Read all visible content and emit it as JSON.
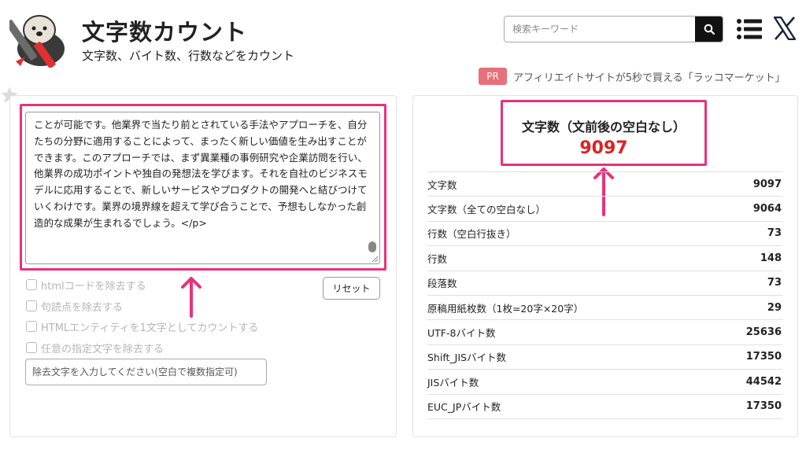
{
  "header": {
    "title": "文字数カウント",
    "subtitle": "文字数、バイト数、行数などをカウント"
  },
  "search": {
    "placeholder": "検索キーワード"
  },
  "promo": {
    "badge": "PR",
    "text": "アフィリエイトサイトが5秒で買える「ラッコマーケット」"
  },
  "editor": {
    "lines": [
      "ことが可能です。他業界で当たり前とされている手法やアプローチを、自分",
      "たちの分野に適用することによって、まったく新しい価値を生み出すことが",
      "できます。このアプローチでは、まず異業種の事例研究や企業訪問を行い、",
      "他業界の成功ポイントや独自の発想法を学びます。それを自社のビジネスモ",
      "デルに応用することで、新しいサービスやプロダクトの開発へと結びつけて",
      "いくわけです。業界の境界線を超えて学び合うことで、予想もしなかった創",
      "造的な成果が生まれるでしょう。</p>"
    ]
  },
  "options": {
    "reset_label": "リセット",
    "checkboxes": [
      "htmlコードを除去する",
      "句読点を除去する",
      "HTMLエンティティを1文字としてカウントする",
      "任意の指定文字を除去する"
    ],
    "remove_placeholder": "除去文字を入力してください(空白で複数指定可)"
  },
  "result": {
    "main_label": "文字数（文前後の空白なし）",
    "main_value": "9097",
    "stats": [
      {
        "label": "文字数",
        "value": "9097"
      },
      {
        "label": "文字数（全ての空白なし）",
        "value": "9064"
      },
      {
        "label": "行数（空白行抜き）",
        "value": "73"
      },
      {
        "label": "行数",
        "value": "148"
      },
      {
        "label": "段落数",
        "value": "73"
      },
      {
        "label": "原稿用紙枚数（1枚=20字×20字）",
        "value": "29"
      },
      {
        "label": "UTF-8バイト数",
        "value": "25636"
      },
      {
        "label": "Shift_JISバイト数",
        "value": "17350"
      },
      {
        "label": "JISバイト数",
        "value": "44542"
      },
      {
        "label": "EUC_JPバイト数",
        "value": "17350"
      }
    ]
  },
  "colors": {
    "highlight": "#e8327a",
    "count_value": "#e02020",
    "pr_badge": "#e8707a"
  },
  "icons": [
    "otter-logo",
    "search-icon",
    "menu-icon",
    "x-logo-icon",
    "star-icon",
    "up-arrow-icon"
  ]
}
